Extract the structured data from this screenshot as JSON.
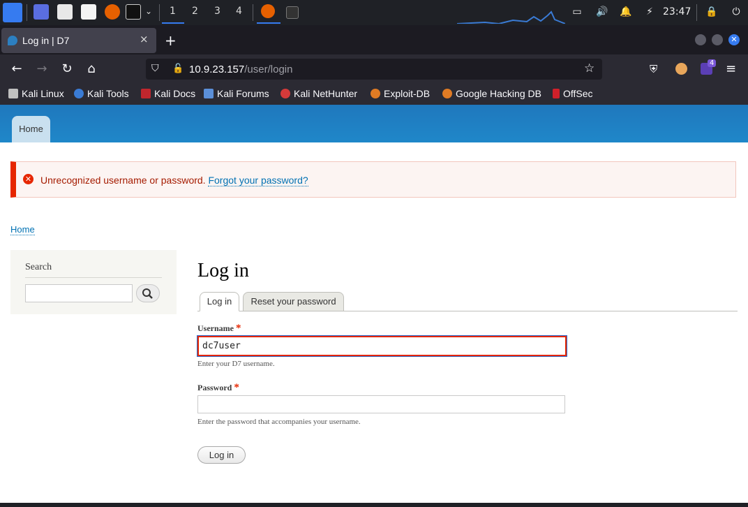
{
  "taskbar": {
    "workspaces": [
      "1",
      "2",
      "3",
      "4"
    ],
    "clock": "23:47"
  },
  "browser": {
    "tab_title": "Log in | D7",
    "tab_close": "×",
    "new_tab": "+",
    "url_host": "10.9.23.157",
    "url_path": "/user/login",
    "extension_badge": "4",
    "bookmarks": [
      {
        "label": "Kali Linux",
        "color": "#c0c0c0"
      },
      {
        "label": "Kali Tools",
        "color": "#3a7bd5"
      },
      {
        "label": "Kali Docs",
        "color": "#c0262d"
      },
      {
        "label": "Kali Forums",
        "color": "#5b8fd9"
      },
      {
        "label": "Kali NetHunter",
        "color": "#d53a3a"
      },
      {
        "label": "Exploit-DB",
        "color": "#e07b24"
      },
      {
        "label": "Google Hacking DB",
        "color": "#e07b24"
      },
      {
        "label": "OffSec",
        "color": "#d0202a"
      }
    ]
  },
  "site": {
    "nav_home": "Home",
    "message": "Unrecognized username or password.",
    "message_link": "Forgot your password?",
    "breadcrumb": "Home",
    "search_title": "Search",
    "page_title": "Log in",
    "tabs": [
      "Log in",
      "Reset your password"
    ],
    "username_label": "Username",
    "username_value": "dc7user",
    "username_desc": "Enter your D7 username.",
    "password_label": "Password",
    "password_desc": "Enter the password that accompanies your username.",
    "required_mark": "*",
    "submit_label": "Log in"
  },
  "colors": {
    "header_blue": "#1f7fc4",
    "error_red": "#e62600",
    "link_blue": "#0071b3"
  }
}
